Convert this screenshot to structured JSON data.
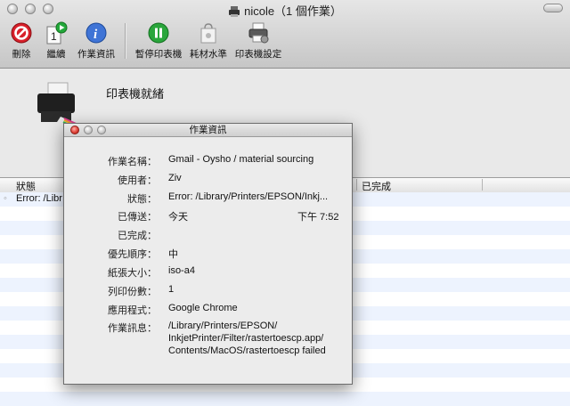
{
  "window": {
    "title": "nicole（1 個作業）"
  },
  "toolbar": {
    "delete": "刪除",
    "resume": "繼續",
    "job_info": "作業資訊",
    "pause_printer": "暫停印表機",
    "supply_levels": "耗材水準",
    "printer_setup": "印表機設定"
  },
  "status": {
    "text": "印表機就緒"
  },
  "list": {
    "headers": {
      "status": "狀態",
      "completed": "已完成"
    },
    "rows": [
      {
        "status": "Error: /Libr"
      }
    ]
  },
  "panel": {
    "title": "作業資訊",
    "fields": [
      {
        "label": "作業名稱：",
        "value": "Gmail - Oysho / material sourcing"
      },
      {
        "label": "使用者：",
        "value": "Ziv"
      },
      {
        "label": "狀態：",
        "value": "Error: /Library/Printers/EPSON/Inkj..."
      },
      {
        "label": "已傳送：",
        "value": "今天",
        "time": "下午 7:52"
      },
      {
        "label": "已完成：",
        "value": ""
      },
      {
        "label": "優先順序：",
        "value": "中"
      },
      {
        "label": "紙張大小：",
        "value": "iso-a4"
      },
      {
        "label": "列印份數：",
        "value": "1"
      },
      {
        "label": "應用程式：",
        "value": "Google Chrome"
      },
      {
        "label": "作業訊息：",
        "value_lines": [
          "/Library/Printers/EPSON/",
          "InkjetPrinter/Filter/rastertoescp.app/",
          "Contents/MacOS/rastertoescp failed"
        ]
      }
    ]
  }
}
